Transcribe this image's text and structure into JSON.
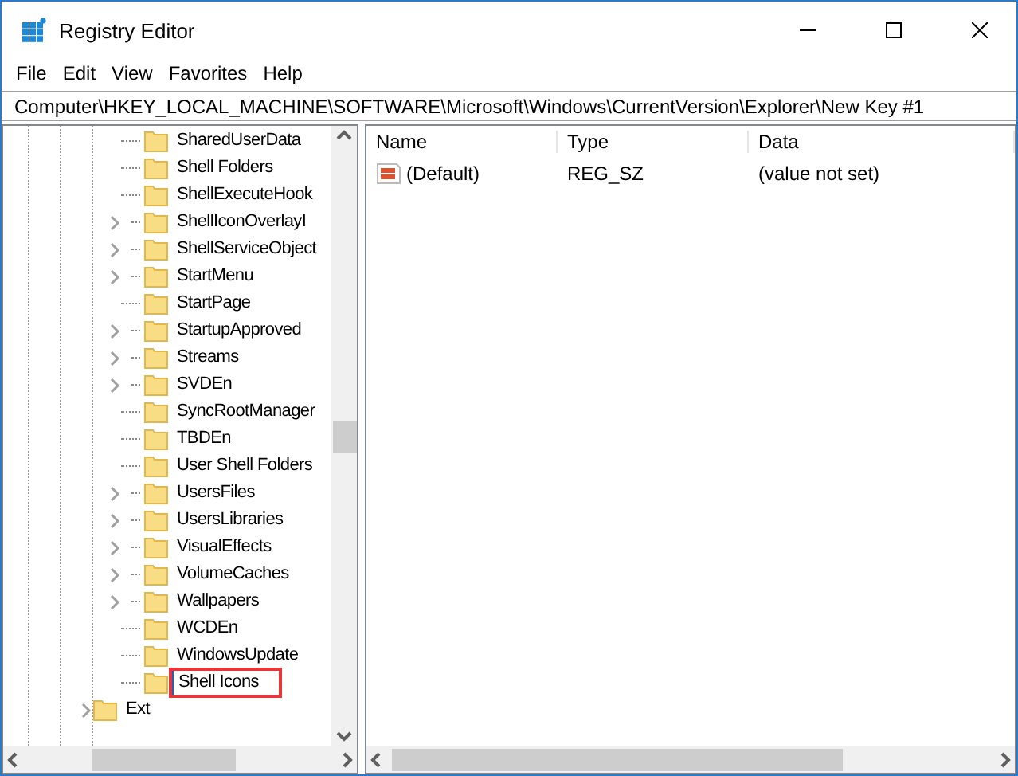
{
  "window": {
    "title": "Registry Editor"
  },
  "menu": [
    "File",
    "Edit",
    "View",
    "Favorites",
    "Help"
  ],
  "address": "Computer\\HKEY_LOCAL_MACHINE\\SOFTWARE\\Microsoft\\Windows\\CurrentVersion\\Explorer\\New Key #1",
  "tree": {
    "items": [
      {
        "label": "SharedUserData",
        "expandable": false,
        "selected": false
      },
      {
        "label": "Shell Folders",
        "expandable": false,
        "selected": false
      },
      {
        "label": "ShellExecuteHook",
        "expandable": false,
        "selected": false
      },
      {
        "label": "ShellIconOverlayI",
        "expandable": true,
        "selected": false
      },
      {
        "label": "ShellServiceObject",
        "expandable": true,
        "selected": false
      },
      {
        "label": "StartMenu",
        "expandable": true,
        "selected": false
      },
      {
        "label": "StartPage",
        "expandable": false,
        "selected": false
      },
      {
        "label": "StartupApproved",
        "expandable": true,
        "selected": false
      },
      {
        "label": "Streams",
        "expandable": true,
        "selected": false
      },
      {
        "label": "SVDEn",
        "expandable": true,
        "selected": false
      },
      {
        "label": "SyncRootManager",
        "expandable": false,
        "selected": false
      },
      {
        "label": "TBDEn",
        "expandable": false,
        "selected": false
      },
      {
        "label": "User Shell Folders",
        "expandable": false,
        "selected": false
      },
      {
        "label": "UsersFiles",
        "expandable": true,
        "selected": false
      },
      {
        "label": "UsersLibraries",
        "expandable": true,
        "selected": false
      },
      {
        "label": "VisualEffects",
        "expandable": true,
        "selected": false
      },
      {
        "label": "VolumeCaches",
        "expandable": true,
        "selected": false
      },
      {
        "label": "Wallpapers",
        "expandable": true,
        "selected": false
      },
      {
        "label": "WCDEn",
        "expandable": false,
        "selected": false
      },
      {
        "label": "WindowsUpdate",
        "expandable": false,
        "selected": false
      },
      {
        "label": "Shell Icons",
        "expandable": false,
        "selected": true
      }
    ],
    "parent_next": {
      "label": "Ext",
      "expandable": true
    }
  },
  "values": {
    "columns": [
      "Name",
      "Type",
      "Data"
    ],
    "rows": [
      {
        "name": "(Default)",
        "type": "REG_SZ",
        "data": "(value not set)"
      }
    ]
  }
}
